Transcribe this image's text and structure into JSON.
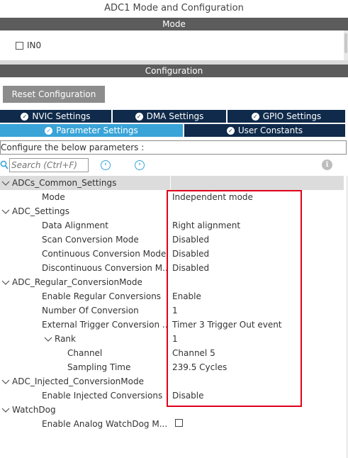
{
  "window": {
    "title": "ADC1 Mode and Configuration"
  },
  "mode": {
    "header": "Mode",
    "items": [
      {
        "label": "IN0",
        "checked": false
      }
    ]
  },
  "configuration": {
    "header": "Configuration",
    "reset_label": "Reset Configuration",
    "tabs_row1": [
      {
        "label": "NVIC Settings"
      },
      {
        "label": "DMA Settings"
      },
      {
        "label": "GPIO Settings"
      }
    ],
    "tabs_row2": [
      {
        "label": "Parameter Settings",
        "active": true
      },
      {
        "label": "User Constants",
        "active": false
      }
    ],
    "instruction": "Configure the below parameters :",
    "search_placeholder": "Search (Ctrl+F)",
    "prev_icon": "chevron-left-circle-icon",
    "next_icon": "chevron-right-circle-icon",
    "info_icon": "info-icon"
  },
  "tree": [
    {
      "label": "ADCs_Common_Settings",
      "level": 0,
      "value": "",
      "expandable": true
    },
    {
      "label": "Mode",
      "level": 1,
      "value": "Independent mode"
    },
    {
      "label": "ADC_Settings",
      "level": 0,
      "value": "",
      "expandable": true
    },
    {
      "label": "Data Alignment",
      "level": 1,
      "value": "Right alignment"
    },
    {
      "label": "Scan Conversion Mode",
      "level": 1,
      "value": "Disabled"
    },
    {
      "label": "Continuous Conversion Mode",
      "level": 1,
      "value": "Disabled"
    },
    {
      "label": "Discontinuous Conversion M...",
      "level": 1,
      "value": "Disabled"
    },
    {
      "label": "ADC_Regular_ConversionMode",
      "level": 0,
      "value": "",
      "expandable": true
    },
    {
      "label": "Enable Regular Conversions",
      "level": 1,
      "value": "Enable"
    },
    {
      "label": "Number Of Conversion",
      "level": 1,
      "value": "1"
    },
    {
      "label": "External Trigger Conversion ...",
      "level": 1,
      "value": "Timer 3 Trigger Out event"
    },
    {
      "label": "Rank",
      "level": 2,
      "value": "1",
      "expandable": true
    },
    {
      "label": "Channel",
      "level": 3,
      "value": "Channel 5"
    },
    {
      "label": "Sampling Time",
      "level": 3,
      "value": "239.5 Cycles"
    },
    {
      "label": "ADC_Injected_ConversionMode",
      "level": 0,
      "value": "",
      "expandable": true
    },
    {
      "label": "Enable Injected Conversions",
      "level": 1,
      "value": "Disable"
    },
    {
      "label": "WatchDog",
      "level": 0,
      "value": "",
      "expandable": true
    },
    {
      "label": "Enable Analog WatchDog M...",
      "level": 1,
      "value": "",
      "checkbox": false
    }
  ],
  "colors": {
    "band": "#5c5c5c",
    "tab_dark": "#0f2a4a",
    "tab_active": "#3aa4d8",
    "highlight_box": "#e0001b"
  }
}
